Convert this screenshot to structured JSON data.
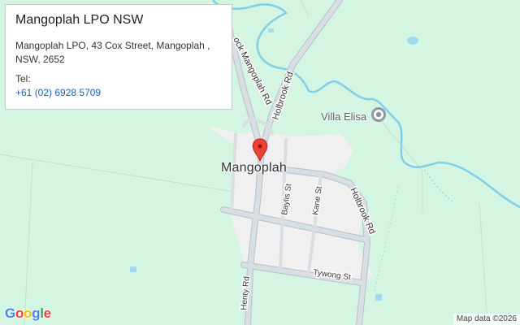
{
  "info_card": {
    "title": "Mangoplah LPO NSW",
    "address_line1": "Mangoplah LPO, 43 Cox Street, Mangoplah ,",
    "address_line2": "NSW, 2652",
    "tel_label": "Tel:",
    "tel_number": "+61 (02) 6928 5709"
  },
  "map": {
    "town_label": "Mangoplah",
    "poi_label": "Villa Elisa",
    "poi_icon": "place-pin-icon",
    "marker_icon": "red-location-marker-icon",
    "roads": {
      "holbrook_rd_north": "Holbrook Rd",
      "holbrook_rd_east": "Holbrook Rd",
      "mangoplah_rd": "ock Mangoplah Rd",
      "baylis_st": "Baylis St",
      "kane_st": "Kane St",
      "tywong_st": "Tywong St",
      "henty_rd": "Henty Rd"
    },
    "colors": {
      "land": "#d4f5e2",
      "town": "#f0f0f0",
      "road": "#c8cdd4",
      "road_outline": "#b4bcc6",
      "water": "#7fd0e8",
      "marker": "#ea4335"
    }
  },
  "footer": {
    "logo_letters": [
      "G",
      "o",
      "o",
      "g",
      "l",
      "e"
    ],
    "logo_colors": [
      "#4285f4",
      "#ea4335",
      "#fbbc05",
      "#4285f4",
      "#34a853",
      "#ea4335"
    ],
    "attribution": "Map data ©2026"
  }
}
